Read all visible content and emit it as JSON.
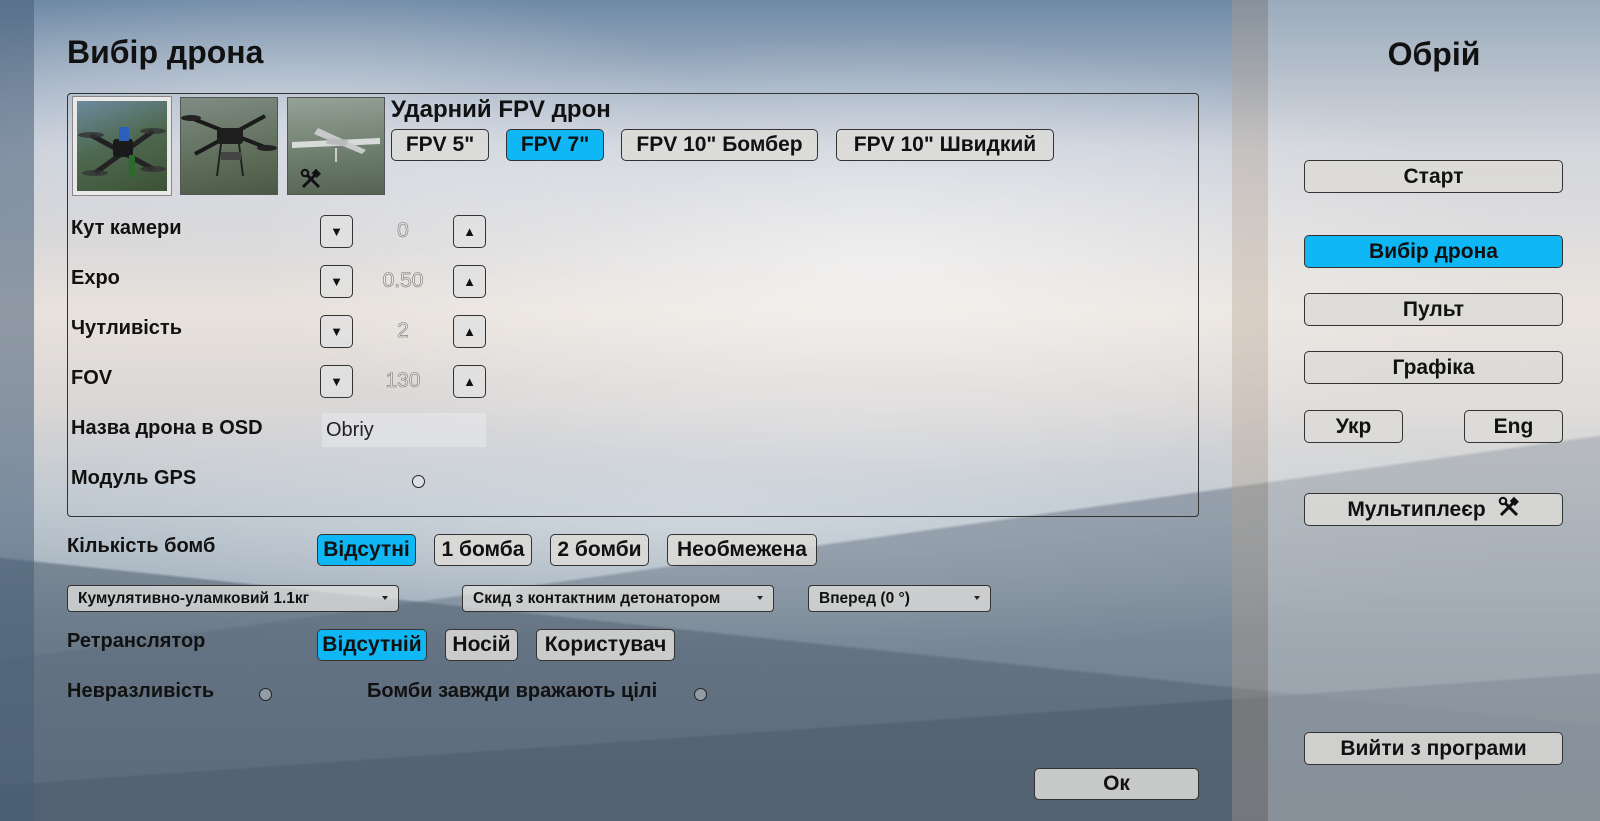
{
  "colors": {
    "accent": "#0fb7f4",
    "button_bg": "#dcdad7",
    "text": "#111111"
  },
  "page": {
    "title": "Вибір дрона"
  },
  "drone_thumbs": [
    {
      "name": "fpv-drone-thumb",
      "selected": true
    },
    {
      "name": "bomber-drone-thumb",
      "selected": false
    },
    {
      "name": "wing-drone-thumb",
      "selected": false,
      "icon": "tools-icon"
    }
  ],
  "drone": {
    "title": "Ударний FPV дрон",
    "variants": [
      {
        "label": "FPV 5\"",
        "active": false
      },
      {
        "label": "FPV 7\"",
        "active": true
      },
      {
        "label": "FPV 10\" Бомбер",
        "active": false
      },
      {
        "label": "FPV 10\" Швидкий",
        "active": false
      }
    ]
  },
  "settings": [
    {
      "label": "Кут камери",
      "value": "0"
    },
    {
      "label": "Expo",
      "value": "0.50"
    },
    {
      "label": "Чутливість",
      "value": "2"
    },
    {
      "label": "FOV",
      "value": "130"
    }
  ],
  "step_icons": {
    "down": "▼",
    "up": "▲"
  },
  "osd": {
    "label": "Назва дрона в OSD",
    "value": "Obriy"
  },
  "gps": {
    "label": "Модуль GPS"
  },
  "bombs": {
    "label": "Кількість бомб",
    "options": [
      {
        "label": "Відсутні",
        "active": true
      },
      {
        "label": "1 бомба",
        "active": false
      },
      {
        "label": "2 бомби",
        "active": false
      },
      {
        "label": "Необмежена",
        "active": false
      }
    ],
    "type_select": "Кумулятивно-уламковий 1.1кг",
    "drop_select": "Скид з контактним детонатором",
    "direction_select": "Вперед (0 °)"
  },
  "relay": {
    "label": "Ретранслятор",
    "options": [
      {
        "label": "Відсутній",
        "active": true
      },
      {
        "label": "Носій",
        "active": false
      },
      {
        "label": "Користувач",
        "active": false
      }
    ]
  },
  "invulnerable": {
    "label": "Невразливість"
  },
  "bombs_always_hit": {
    "label": "Бомби завжди вражають цілі"
  },
  "ok_button": "Ок",
  "sidebar": {
    "app_title": "Обрій",
    "start": "Старт",
    "drone_select": "Вибір дрона",
    "controller": "Пульт",
    "graphics": "Графіка",
    "lang_ukr": "Укр",
    "lang_eng": "Eng",
    "multiplayer": "Мультиплеєр",
    "exit": "Вийти з програми"
  }
}
